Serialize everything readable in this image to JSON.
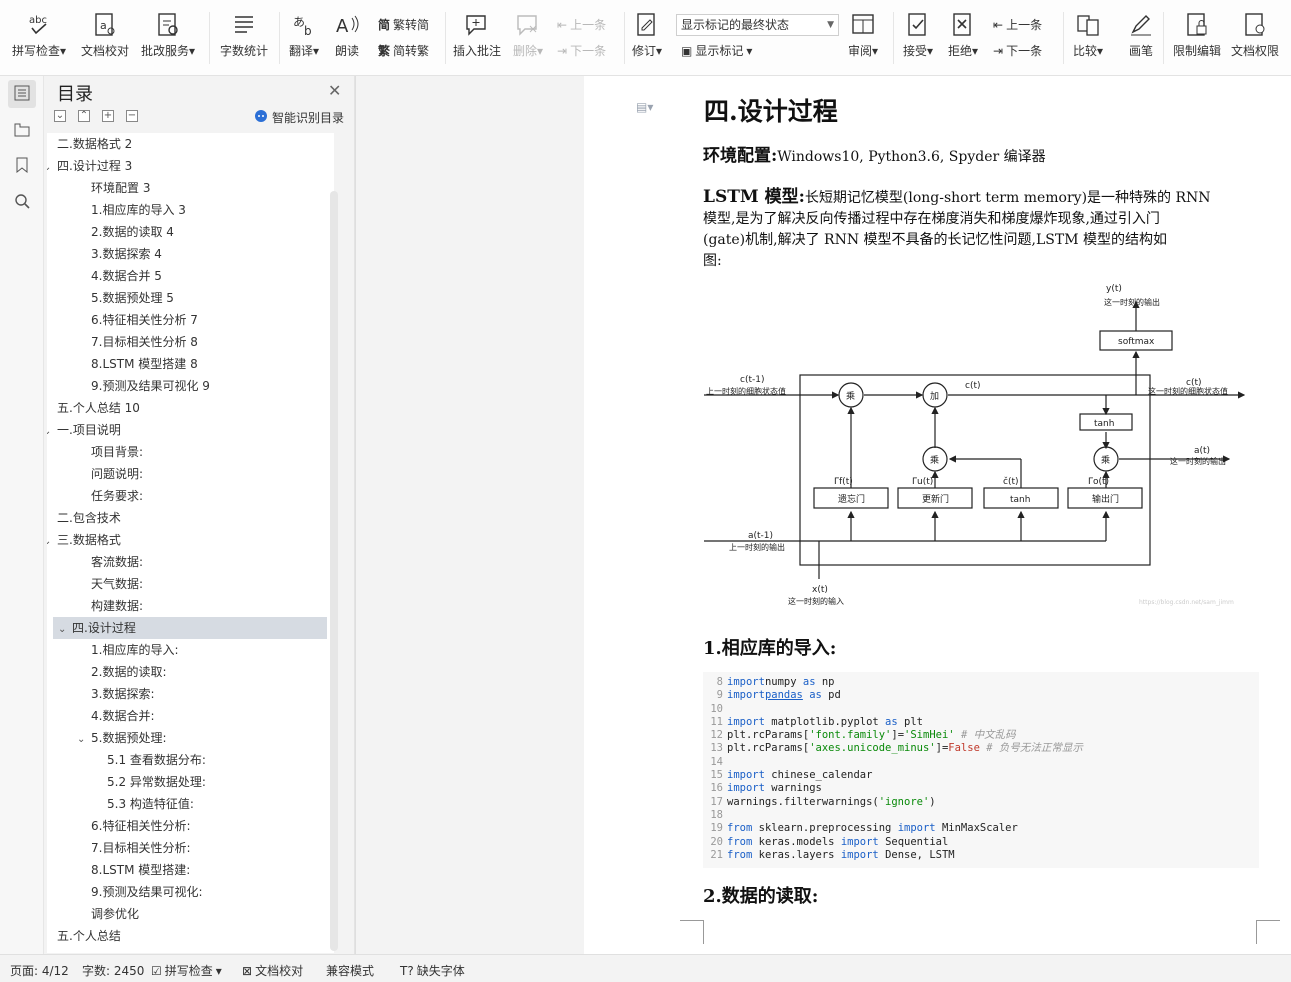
{
  "toolbar": {
    "buttons": [
      {
        "label": "拼写检查"
      },
      {
        "label": "文档校对"
      },
      {
        "label": "批改服务"
      },
      {
        "label": "字数统计"
      },
      {
        "label": "翻译"
      },
      {
        "label": "朗读"
      },
      {
        "label": "插入批注"
      },
      {
        "label": "删除"
      },
      {
        "label": "修订"
      },
      {
        "label": "审阅"
      },
      {
        "label": "接受"
      },
      {
        "label": "拒绝"
      },
      {
        "label": "比较"
      },
      {
        "label": "画笔"
      },
      {
        "label": "限制编辑"
      },
      {
        "label": "文档权限"
      }
    ],
    "small": {
      "fan_to_jian": "繁转简",
      "jian_to_fan": "简转繁",
      "prev_comment": "上一条",
      "next_comment": "下一条",
      "show_markup": "显示标记",
      "prev_change": "上一条",
      "next_change": "下一条"
    },
    "markup_select": "显示标记的最终状态"
  },
  "nav": {
    "title": "目录",
    "smart_toc": "智能识别目录",
    "items": [
      {
        "text": "二.数据格式 2",
        "level": 1,
        "chevron": false
      },
      {
        "text": "四.设计过程 3",
        "level": 1,
        "chevron": true
      },
      {
        "text": "环境配置 3",
        "level": 2,
        "chevron": false
      },
      {
        "text": "1.相应库的导入 3",
        "level": 2,
        "chevron": false
      },
      {
        "text": "2.数据的读取 4",
        "level": 2,
        "chevron": false
      },
      {
        "text": "3.数据探索 4",
        "level": 2,
        "chevron": false
      },
      {
        "text": "4.数据合并 5",
        "level": 2,
        "chevron": false
      },
      {
        "text": "5.数据预处理 5",
        "level": 2,
        "chevron": false
      },
      {
        "text": "6.特征相关性分析 7",
        "level": 2,
        "chevron": false
      },
      {
        "text": "7.目标相关性分析 8",
        "level": 2,
        "chevron": false
      },
      {
        "text": "8.LSTM 模型搭建 8",
        "level": 2,
        "chevron": false
      },
      {
        "text": "9.预测及结果可视化 9",
        "level": 2,
        "chevron": false
      },
      {
        "text": "五.个人总结 10",
        "level": 1,
        "chevron": false
      },
      {
        "text": "一.项目说明",
        "level": 1,
        "chevron": true
      },
      {
        "text": "项目背景:",
        "level": 2,
        "chevron": false
      },
      {
        "text": "问题说明:",
        "level": 2,
        "chevron": false
      },
      {
        "text": "任务要求:",
        "level": 2,
        "chevron": false
      },
      {
        "text": "二.包含技术",
        "level": 1,
        "chevron": false
      },
      {
        "text": "三.数据格式",
        "level": 1,
        "chevron": true
      },
      {
        "text": "客流数据:",
        "level": 2,
        "chevron": false
      },
      {
        "text": "天气数据:",
        "level": 2,
        "chevron": false
      },
      {
        "text": "构建数据:",
        "level": 2,
        "chevron": false
      },
      {
        "text": "四.设计过程",
        "level": 1,
        "chevron": true,
        "selected": true
      },
      {
        "text": "1.相应库的导入:",
        "level": 2,
        "chevron": false
      },
      {
        "text": "2.数据的读取:",
        "level": 2,
        "chevron": false
      },
      {
        "text": "3.数据探索:",
        "level": 2,
        "chevron": false
      },
      {
        "text": "4.数据合并:",
        "level": 2,
        "chevron": false
      },
      {
        "text": "5.数据预处理:",
        "level": 2,
        "chevron": true
      },
      {
        "text": "5.1 查看数据分布:",
        "level": 3,
        "chevron": false
      },
      {
        "text": "5.2 异常数据处理:",
        "level": 3,
        "chevron": false
      },
      {
        "text": "5.3 构造特征值:",
        "level": 3,
        "chevron": false
      },
      {
        "text": "6.特征相关性分析:",
        "level": 2,
        "chevron": false
      },
      {
        "text": "7.目标相关性分析:",
        "level": 2,
        "chevron": false
      },
      {
        "text": "8.LSTM 模型搭建:",
        "level": 2,
        "chevron": false
      },
      {
        "text": "9.预测及结果可视化:",
        "level": 2,
        "chevron": false
      },
      {
        "text": "调参优化",
        "level": 2,
        "chevron": false
      },
      {
        "text": "五.个人总结",
        "level": 1,
        "chevron": false
      }
    ]
  },
  "doc": {
    "heading": "四.设计过程",
    "env_label": "环境配置:",
    "env_text": "Windows10, Python3.6,    Spyder 编译器",
    "lstm_label": "LSTM 模型:",
    "lstm_lines": [
      "长短期记忆模型(long-short term memory)是一种特殊的 RNN",
      "模型,是为了解决反向传播过程中存在梯度消失和梯度爆炸现象,通过引入门",
      "(gate)机制,解决了 RNN 模型不具备的长记忆性问题,LSTM 模型的结构如",
      "图:"
    ],
    "diagram": {
      "yt": "y(t)",
      "yt_sub": "这一时刻的输出",
      "softmax": "softmax",
      "ct1": "c(t-1)",
      "ct1_sub": "上一时刻的细胞状态值",
      "ct": "c(t)",
      "ct_r": "c(t)",
      "ct_r_sub": "这一时刻的细胞状态值",
      "mul": "乘",
      "add": "加",
      "tanh": "tanh",
      "at": "a(t)",
      "at_sub": "这一时刻的输出",
      "ft": "Γf(t)",
      "ut": "Γu(t)",
      "cct": "č(t)",
      "ot": "Γo(t)",
      "forget": "遗忘门",
      "update": "更新门",
      "tanh2": "tanh",
      "output": "输出门",
      "at1": "a(t-1)",
      "at1_sub": "上一时刻的输出",
      "xt": "x(t)",
      "xt_sub": "这一时刻的输入",
      "watermark": "https://blog.csdn.net/sam_jimm"
    },
    "section1": "1.相应库的导入:",
    "code_lines": [
      {
        "n": "8",
        "parts": [
          [
            "kw",
            "import"
          ],
          [
            "",
            "numpy "
          ],
          [
            "kw",
            "as"
          ],
          [
            "",
            " np"
          ]
        ]
      },
      {
        "n": "9",
        "parts": [
          [
            "kw",
            "import"
          ],
          [
            "",
            ""
          ],
          [
            "ul",
            "pandas"
          ],
          [
            "",
            " "
          ],
          [
            "kw",
            "as"
          ],
          [
            "",
            " pd"
          ]
        ]
      },
      {
        "n": "10",
        "parts": []
      },
      {
        "n": "11",
        "parts": [
          [
            "kw",
            "import"
          ],
          [
            "",
            " matplotlib.pyplot "
          ],
          [
            "kw",
            "as"
          ],
          [
            "",
            " plt"
          ]
        ]
      },
      {
        "n": "12",
        "parts": [
          [
            "",
            "plt.rcParams["
          ],
          [
            "st",
            "'font.family'"
          ],
          [
            "",
            "]="
          ],
          [
            "st",
            "'SimHei'"
          ],
          [
            "",
            " "
          ],
          [
            "cm",
            "# 中文乱码"
          ]
        ]
      },
      {
        "n": "13",
        "parts": [
          [
            "",
            "plt.rcParams["
          ],
          [
            "st",
            "'axes.unicode_minus'"
          ],
          [
            "",
            "]="
          ],
          [
            "fl",
            "False"
          ],
          [
            "",
            " "
          ],
          [
            "cm",
            "# 负号无法正常显示"
          ]
        ]
      },
      {
        "n": "14",
        "parts": []
      },
      {
        "n": "15",
        "parts": [
          [
            "kw",
            "import"
          ],
          [
            "",
            " chinese_calendar"
          ]
        ]
      },
      {
        "n": "16",
        "parts": [
          [
            "kw",
            "import"
          ],
          [
            "",
            " warnings"
          ]
        ]
      },
      {
        "n": "17",
        "parts": [
          [
            "",
            "warnings.filterwarnings("
          ],
          [
            "st",
            "'ignore'"
          ],
          [
            "",
            ")"
          ]
        ]
      },
      {
        "n": "18",
        "parts": []
      },
      {
        "n": "19",
        "parts": [
          [
            "kw",
            "from"
          ],
          [
            "",
            " sklearn.preprocessing "
          ],
          [
            "kw",
            "import"
          ],
          [
            "",
            " MinMaxScaler"
          ]
        ]
      },
      {
        "n": "20",
        "parts": [
          [
            "kw",
            "from"
          ],
          [
            "",
            " keras.models "
          ],
          [
            "kw",
            "import"
          ],
          [
            "",
            " Sequential"
          ]
        ]
      },
      {
        "n": "21",
        "parts": [
          [
            "kw",
            "from"
          ],
          [
            "",
            " keras.layers "
          ],
          [
            "kw",
            "import"
          ],
          [
            "",
            " Dense, LSTM"
          ]
        ]
      }
    ],
    "section2": "2.数据的读取:"
  },
  "status": {
    "page": "页面: 4/12",
    "words": "字数: 2450",
    "spell": "拼写检查",
    "proof": "文档校对",
    "compat": "兼容模式",
    "font": "缺失字体"
  },
  "colors": {
    "accent": "#2b6fd6",
    "selected": "#d6dbe2"
  }
}
